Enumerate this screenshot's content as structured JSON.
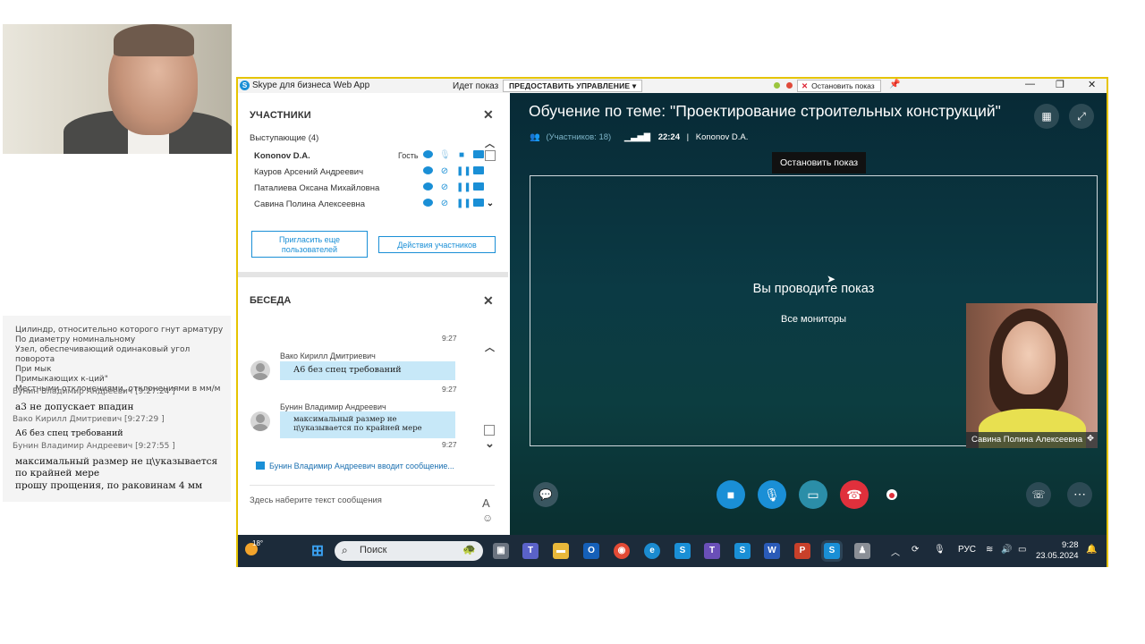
{
  "side_chat": {
    "notes": [
      "Цилиндр, относительно которого гнут арматуру",
      "По диаметру номинальному",
      "Узел, обеспечивающий одинаковый угол поворота",
      "При мык",
      "Примыкающих к-ций\"",
      "Местными отклонениями, отклонениями в мм/м"
    ],
    "entries": [
      {
        "author": "Бунин Владимир Андреевич",
        "time": "[9:27:24 ]",
        "text": "а3 не допускает впадин"
      },
      {
        "author": "Вако Кирилл Дмитриевич",
        "time": "[9:27:29 ]",
        "text": "А6 без спец требований"
      },
      {
        "author": "Бунин Владимир Андреевич",
        "time": "[9:27:55 ]",
        "text": "максимальный размер не ц\\указывается по крайней мере"
      }
    ],
    "last_line": "прошу прощения, по раковинам 4 мм"
  },
  "window": {
    "title": "Skype для бизнеса Web App",
    "showing_label": "Идет показ",
    "give_control": "ПРЕДОСТАВИТЬ УПРАВЛЕНИЕ",
    "stop_showing": "Остановить показ"
  },
  "participants": {
    "header": "УЧАСТНИКИ",
    "group": "Выступающие (4)",
    "guest_label": "Гость",
    "people": [
      {
        "name": "Kononov D.A."
      },
      {
        "name": "Кауров Арсений Андреевич"
      },
      {
        "name": "Паталиева Оксана Михайловна"
      },
      {
        "name": "Савина Полина Алексеевна"
      }
    ],
    "invite_button": "Пригласить еще пользователей",
    "actions_button": "Действия участников"
  },
  "chat": {
    "header": "БЕСЕДА",
    "messages": [
      {
        "time_top": "9:27",
        "author": "Вако Кирилл Дмитриевич",
        "text": "А6 без спец требований",
        "time": "9:27"
      },
      {
        "author": "Бунин Владимир Андреевич",
        "text": "максимальный размер не ц\\указывается по крайней мере",
        "time": "9:27"
      }
    ],
    "typing": "Бунин Владимир Андреевич вводит сообщение...",
    "input_placeholder": "Здесь наберите текст сообщения"
  },
  "meeting": {
    "title": "Обучение по теме: \"Проектирование строительных конструкций\"",
    "participants_count": "(Участников: 18)",
    "duration": "22:24",
    "organizer": "Kononov D.A.",
    "tooltip": "Остановить показ",
    "share_title": "Вы проводите показ",
    "share_subtitle": "Все мониторы",
    "pip_name": "Савина Полина Алексеевна"
  },
  "taskbar": {
    "temperature": "18°",
    "search_placeholder": "Поиск",
    "language": "РУС",
    "time": "9:28",
    "date": "23.05.2024"
  },
  "colors": {
    "accent": "#1a8fd6",
    "stage_bg": "#0b3a44",
    "end_call": "#e0303c",
    "window_border": "#e6c400"
  }
}
